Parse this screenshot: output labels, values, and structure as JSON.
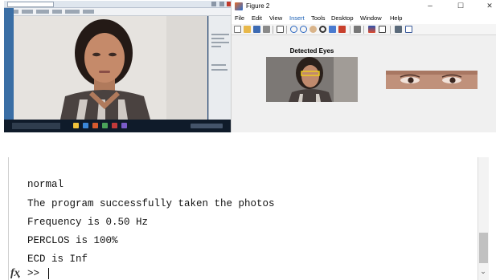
{
  "figure": {
    "title": "Figure 2",
    "menu": [
      "File",
      "Edit",
      "View",
      "Insert",
      "Tools",
      "Desktop",
      "Window",
      "Help"
    ],
    "active_menu": "Insert",
    "window_buttons": {
      "minimize": "–",
      "maximize": "☐",
      "close": "✕"
    },
    "axes_title": "Detected Eyes",
    "toolbar_icons": [
      "new-figure-icon",
      "open-icon",
      "save-icon",
      "print-icon",
      "pointer-icon",
      "zoom-in-icon",
      "zoom-out-icon",
      "pan-icon",
      "rotate-icon",
      "data-cursor-icon",
      "brush-icon",
      "link-icon",
      "colorbar-icon",
      "legend-icon",
      "hide-plot-tools-icon",
      "show-plot-tools-icon"
    ]
  },
  "command_window": {
    "lines": [
      "normal",
      "The program successfully taken the photos",
      "Frequency is 0.50 Hz",
      "PERCLOS is 100%",
      "ECD is Inf"
    ],
    "prompt": ">>",
    "fx_label": "fx",
    "fx_arrow": "▾",
    "scroll_down_arrow": "⌄"
  },
  "colors": {
    "desktop_bg": "#2b4d7a",
    "taskbar": "#0f1b2a",
    "figure_bg": "#f0f0f0",
    "active_menu": "#1a5fb4",
    "eye_highlight": "#f2d21b"
  }
}
